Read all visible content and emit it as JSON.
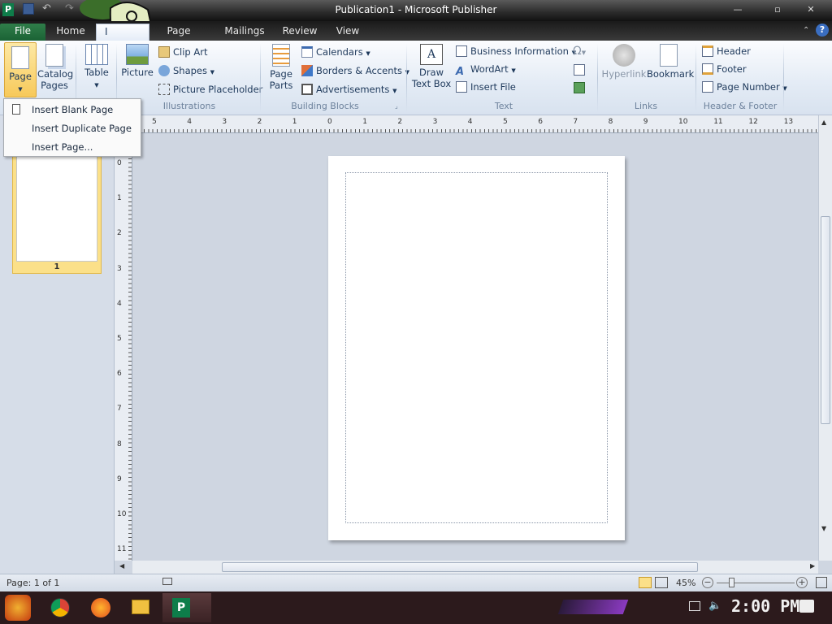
{
  "window": {
    "title": "Publication1 - Microsoft Publisher"
  },
  "tabs": [
    "File",
    "Home",
    "I",
    "Page Design",
    "Mailings",
    "Review",
    "View"
  ],
  "ribbon": {
    "pages_group": {
      "page": "Page",
      "catalog": "Catalog\nPages"
    },
    "tables": {
      "table": "Table"
    },
    "illustrations": {
      "label": "Illustrations",
      "picture": "Picture",
      "clip_art": "Clip Art",
      "shapes": "Shapes",
      "placeholder": "Picture Placeholder"
    },
    "building_blocks": {
      "label": "Building Blocks",
      "page_parts": "Page\nParts",
      "calendars": "Calendars",
      "borders": "Borders & Accents",
      "ads": "Advertisements"
    },
    "text": {
      "label": "Text",
      "draw": "Draw\nText Box",
      "business": "Business Information",
      "wordart": "WordArt",
      "insert_file": "Insert File",
      "symbol": "Ω"
    },
    "links": {
      "label": "Links",
      "hyperlink": "Hyperlink",
      "bookmark": "Bookmark"
    },
    "header_footer": {
      "label": "Header & Footer",
      "header": "Header",
      "footer": "Footer",
      "page_number": "Page Number"
    }
  },
  "page_menu": {
    "items": [
      "Insert Blank Page",
      "Insert Duplicate Page",
      "Insert Page..."
    ]
  },
  "thumbnail": {
    "number": "1"
  },
  "status": {
    "page": "Page: 1 of 1",
    "zoom": "45%"
  },
  "taskbar": {
    "time": "2:00 PM"
  },
  "hruler_ticks": [
    "5",
    "4",
    "3",
    "2",
    "1",
    "0",
    "1",
    "2",
    "3",
    "4",
    "5",
    "6",
    "7",
    "8",
    "9",
    "10",
    "11",
    "12",
    "13"
  ],
  "vruler_ticks": [
    "0",
    "1",
    "2",
    "3",
    "4",
    "5",
    "6",
    "7",
    "8",
    "9",
    "10",
    "11"
  ],
  "colors": {
    "file_tab": "#1b6235",
    "ribbon": "#e3ebf5",
    "highlight": "#fbe089"
  }
}
